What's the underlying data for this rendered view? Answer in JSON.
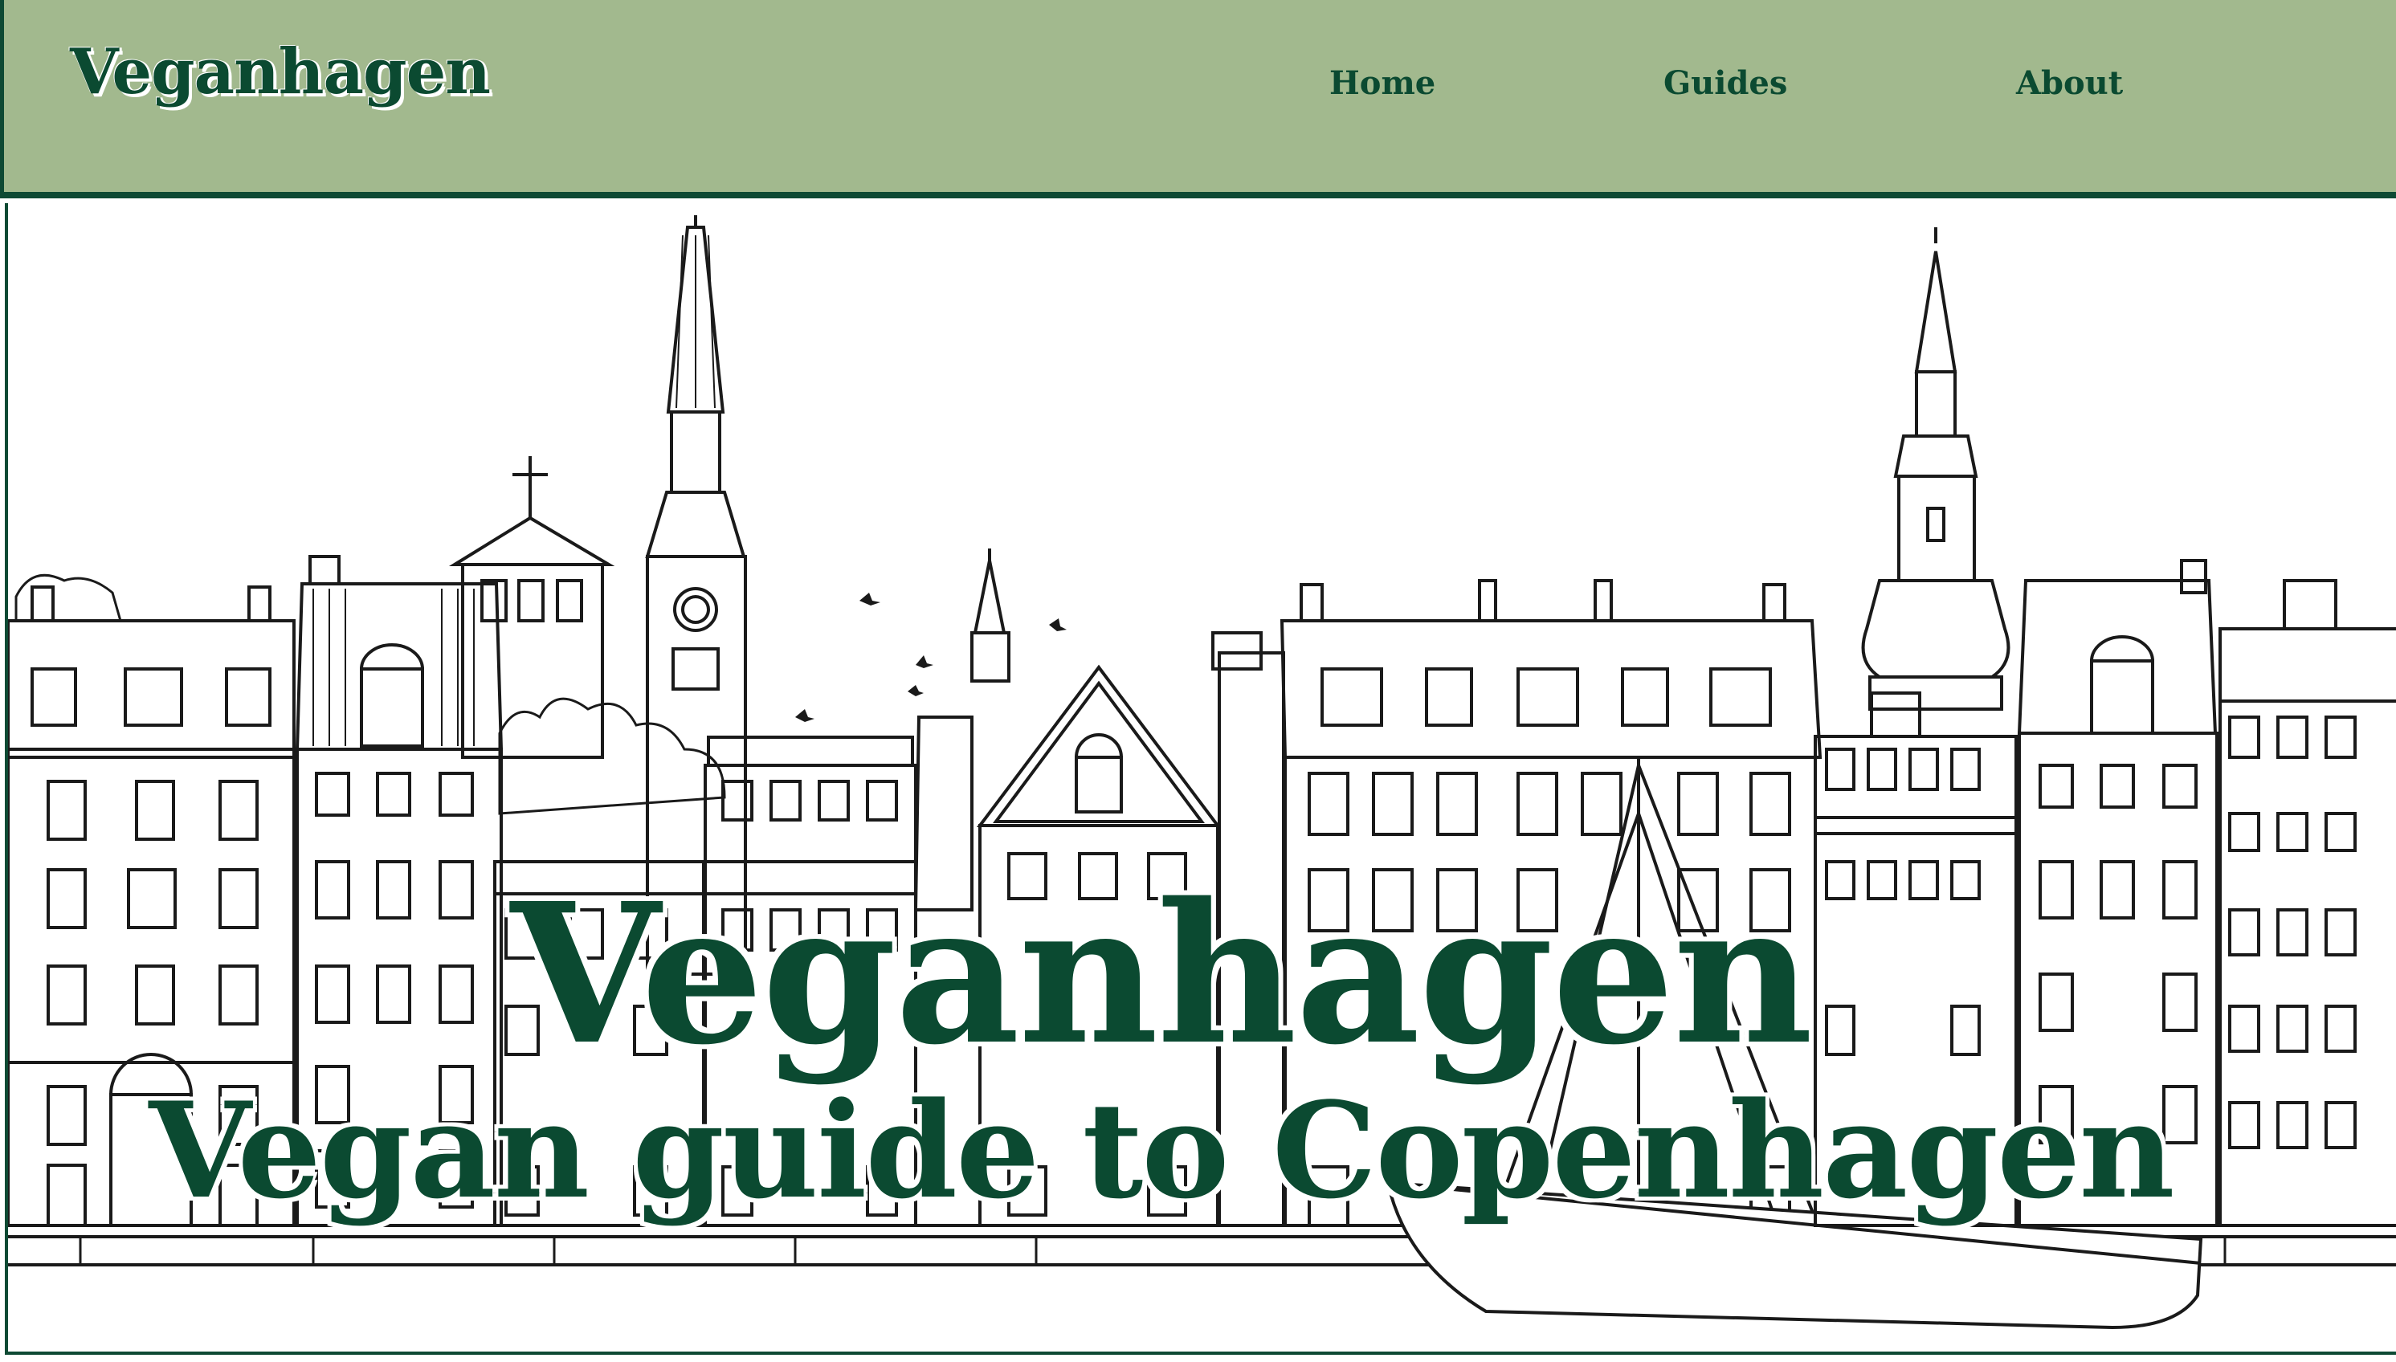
{
  "header": {
    "logo": "Veganhagen",
    "nav": {
      "home": "Home",
      "guides": "Guides",
      "about": "About"
    }
  },
  "hero": {
    "illustration": "copenhagen-skyline-line-drawing",
    "title": "Veganhagen",
    "subtitle": "Vegan guide to Copenhagen"
  },
  "colors": {
    "header_bg": "#a2b98e",
    "brand_green": "#0b4a31",
    "background": "#ffffff"
  }
}
